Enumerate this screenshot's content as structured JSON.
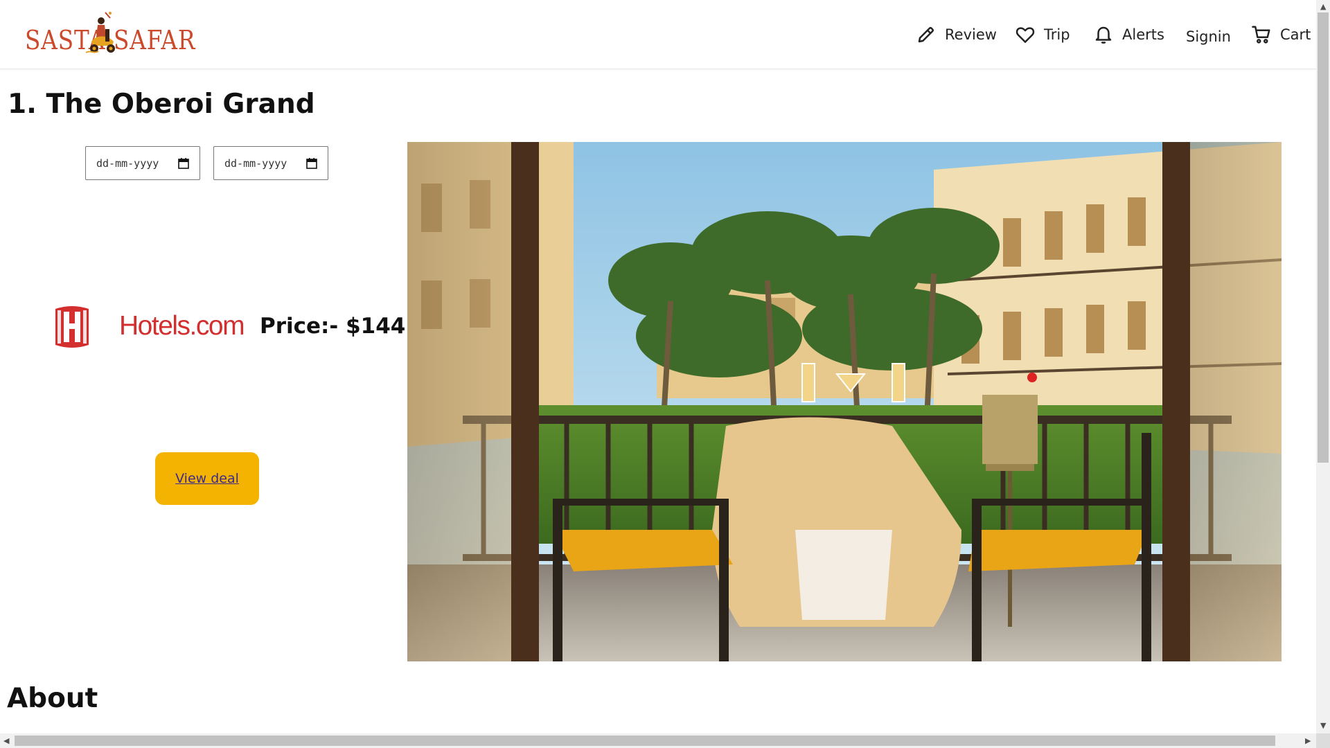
{
  "brand": {
    "name_left": "SASTA",
    "name_right": "SAFAR",
    "color": "#cc4a2c"
  },
  "nav": {
    "review": "Review",
    "trip": "Trip",
    "alerts": "Alerts",
    "signin": "Signin",
    "cart": "Cart"
  },
  "hotel": {
    "title": "1. The Oberoi Grand",
    "checkin_placeholder": "dd-mm-yyyy",
    "checkout_placeholder": "dd-mm-yyyy",
    "provider": "Hotels.com",
    "price": "Price:- $144",
    "deal_label": "View deal",
    "deal_color": "#f3b300"
  },
  "about": {
    "heading": "About"
  }
}
